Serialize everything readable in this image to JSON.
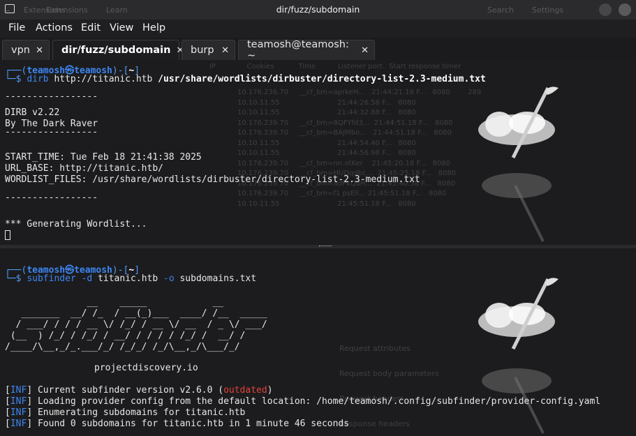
{
  "window": {
    "title": "dir/fuzz/subdomain",
    "ghost_left": [
      "Extensions",
      "Learn"
    ],
    "ghost_right": [
      "Search",
      "Settings"
    ]
  },
  "menubar": {
    "items": [
      "File",
      "Actions",
      "Edit",
      "View",
      "Help"
    ]
  },
  "tabs": [
    {
      "label": "vpn",
      "close": "✕"
    },
    {
      "label": "dir/fuzz/subdomain",
      "close": "✕"
    },
    {
      "label": "burp",
      "close": "✕"
    },
    {
      "label": "teamosh@teamosh: ~",
      "close": "✕"
    }
  ],
  "pane1": {
    "prompt_user": "teamosh㉿teamosh",
    "prompt_dir": "~",
    "cmd": "dirb",
    "cmd_args": " http://titanic.htb ",
    "cmd_wordlist": "/usr/share/wordlists/dirbuster/directory-list-2.3-medium.txt",
    "sep1": "-----------------",
    "banner1": "DIRB v2.22",
    "banner2": "By The Dark Raver",
    "sep2": "-----------------",
    "start_time": "START_TIME: Tue Feb 18 21:41:38 2025",
    "url_base": "URL_BASE: http://titanic.htb/",
    "wordlist_files": "WORDLIST_FILES: /usr/share/wordlists/dirbuster/directory-list-2.3-medium.txt",
    "sep3": "-----------------",
    "generating": "*** Generating Wordlist..."
  },
  "pane2": {
    "prompt_user": "teamosh㉿teamosh",
    "prompt_dir": "~",
    "cmd": "subfinder",
    "flag1": " -d",
    "host": " titanic.htb",
    "flag2": " -o",
    "outfile": " subdomains.txt",
    "ascii": [
      "               __    _____            __",
      "   _______  __/ /_  / __(_)___  ____/ /__  _____",
      "  / ___/ / / / __ \\/ /_/ / __ \\/ __  / _ \\/ ___/",
      " (__  ) /_/ / /_/ / __/ / / / / /_/ /  __/ /",
      "/____/\\__,_/_.___/_/ /_/_/ /_/\\__,_/\\___/_/"
    ],
    "site": "projectdiscovery.io",
    "logs": [
      {
        "tag": "INF",
        "text": "Current subfinder version v2.6.0 (",
        "extra": "outdated",
        "tail": ")"
      },
      {
        "tag": "INF",
        "text": "Loading provider config from the default location: /home/teamosh/.config/subfinder/provider-config.yaml",
        "extra": "",
        "tail": ""
      },
      {
        "tag": "INF",
        "text": "Enumerating subdomains for titanic.htb",
        "extra": "",
        "tail": ""
      },
      {
        "tag": "INF",
        "text": "Found 0 subdomains for titanic.htb in 1 minute 46 seconds",
        "extra": "",
        "tail": ""
      }
    ]
  }
}
